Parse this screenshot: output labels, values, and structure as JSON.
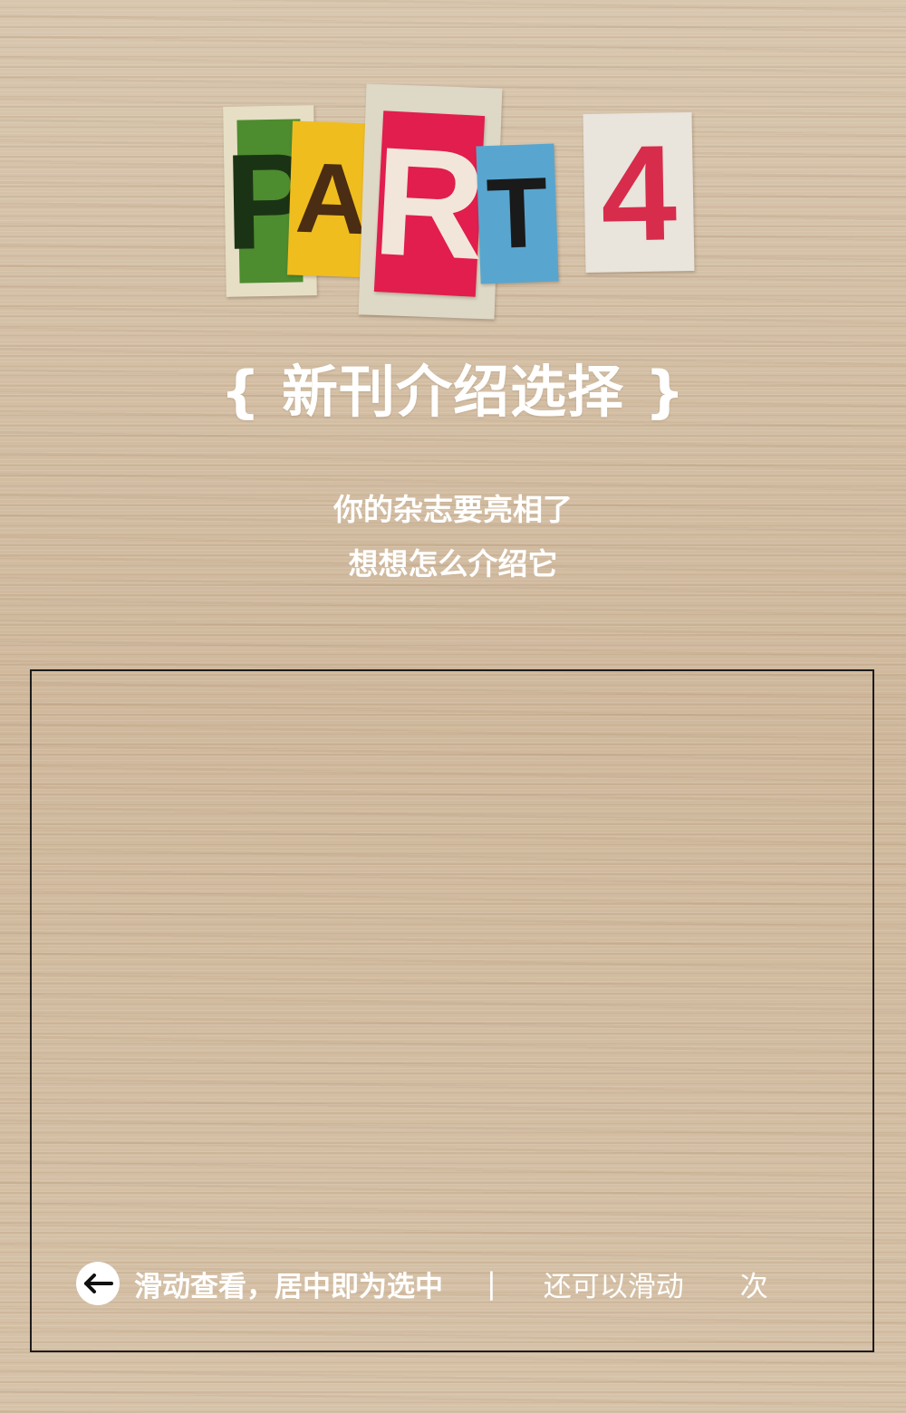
{
  "header": {
    "part_letters": [
      "P",
      "A",
      "R",
      "T",
      "4"
    ],
    "section_title": "{ 新刊介绍选择 }"
  },
  "intro": {
    "line1": "你的杂志要亮相了",
    "line2": "想想怎么介绍它"
  },
  "carousel": {
    "hint_primary": "滑动查看，居中即为选中",
    "divider": "|",
    "hint_secondary": "还可以滑动",
    "hint_tail": "次",
    "back_icon": "arrow-left-icon"
  },
  "colors": {
    "part_p": "#4d8c2f",
    "part_a": "#f0bd1f",
    "part_r": "#e11e4d",
    "part_t": "#58a6cf",
    "part_4": "#d72c4b",
    "text": "#ffffff",
    "frame_border": "#1c1c1c"
  }
}
